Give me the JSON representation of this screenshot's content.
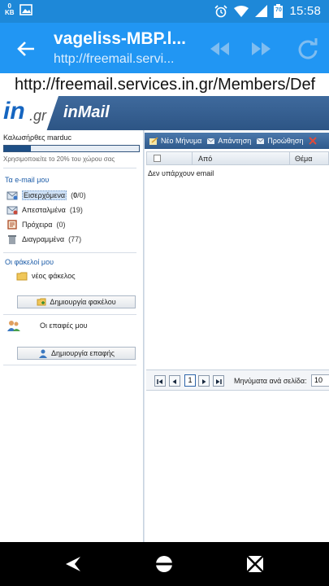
{
  "status_bar": {
    "kb_value": "0",
    "kb_unit": "KB",
    "battery": "70",
    "time": "15:58"
  },
  "app_bar": {
    "title": "vageliss-MBP.l...",
    "subtitle": "http://freemail.servi..."
  },
  "url_bar": {
    "text": "http://freemail.services.in.gr/Members/Def"
  },
  "header": {
    "logo_in": "in",
    "logo_gr": ".gr",
    "product": "inMail"
  },
  "sidebar": {
    "welcome": "Καλωσήρθες marduc",
    "quota_fraction": 0.2,
    "quota_text": "Χρησιμοποιείτε το 20% του χώρου σας",
    "my_email_title": "Τα e-mail μου",
    "folders": [
      {
        "label": "Εισερχόμενα",
        "count": "(0/0)",
        "bold_part": "0",
        "icon": "inbox-icon"
      },
      {
        "label": "Απεσταλμένα",
        "count": "(19)",
        "icon": "sent-icon"
      },
      {
        "label": "Πρόχειρα",
        "count": "(0)",
        "icon": "drafts-icon"
      },
      {
        "label": "Διαγραμμένα",
        "count": "(77)",
        "icon": "trash-icon"
      }
    ],
    "my_folders_title": "Οι φάκελοί μου",
    "new_folder": "νέος φάκελος",
    "create_folder_button": "Δημιουργία φακέλου",
    "contacts_label": "Οι επαφές μου",
    "create_contact_button": "Δημιουργία επαφής"
  },
  "toolbar": {
    "new_message": "Νέο Μήνυμα",
    "reply": "Απάντηση",
    "forward": "Προώθηση"
  },
  "grid": {
    "col_from": "Από",
    "col_subject": "Θέμα",
    "empty_text": "Δεν υπάρχουν email"
  },
  "pager": {
    "page": "1",
    "per_page_label": "Μηνύματα ανά σελίδα:",
    "per_page_value": "10"
  },
  "colors": {
    "accent": "#2196f3",
    "status_bar": "#1e88d8",
    "header": "#2d5585"
  }
}
